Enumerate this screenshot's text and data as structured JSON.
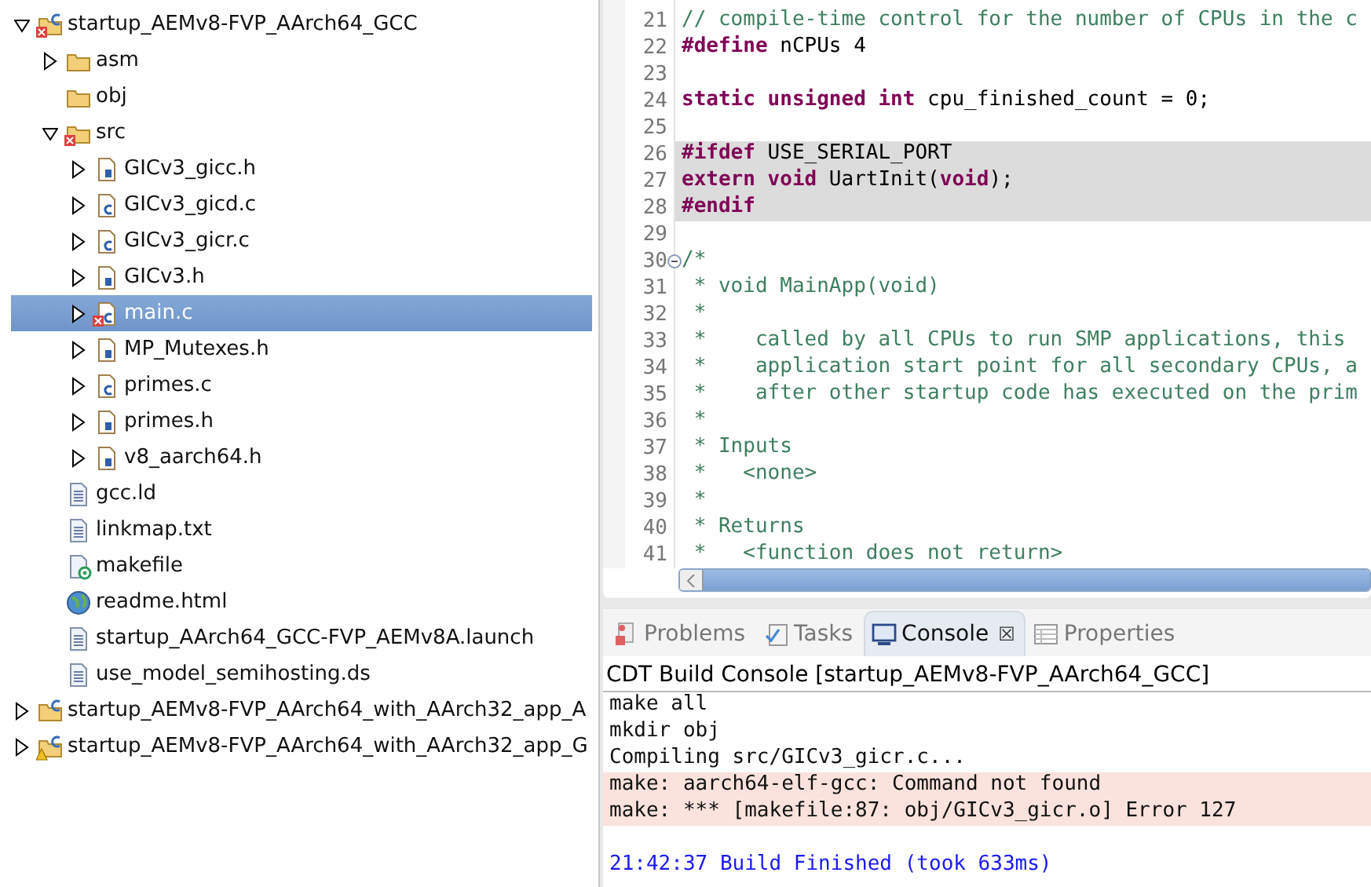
{
  "project_explorer": {
    "tree": [
      {
        "label": "startup_AEMv8-FVP_AArch64_GCC",
        "kind": "project",
        "error": true,
        "expanded": true,
        "selected": false,
        "children": [
          {
            "label": "asm",
            "kind": "folder",
            "expanded": false,
            "selected": false
          },
          {
            "label": "obj",
            "kind": "folder",
            "selected": false
          },
          {
            "label": "src",
            "kind": "folder",
            "error": true,
            "expanded": true,
            "selected": false,
            "children": [
              {
                "label": "GICv3_gicc.h",
                "kind": "header",
                "expanded": false,
                "selected": false
              },
              {
                "label": "GICv3_gicd.c",
                "kind": "source",
                "expanded": false,
                "selected": false
              },
              {
                "label": "GICv3_gicr.c",
                "kind": "source",
                "expanded": false,
                "selected": false
              },
              {
                "label": "GICv3.h",
                "kind": "header",
                "expanded": false,
                "selected": false
              },
              {
                "label": "main.c",
                "kind": "source",
                "error": true,
                "expanded": false,
                "selected": true
              },
              {
                "label": "MP_Mutexes.h",
                "kind": "header",
                "expanded": false,
                "selected": false
              },
              {
                "label": "primes.c",
                "kind": "source",
                "expanded": false,
                "selected": false
              },
              {
                "label": "primes.h",
                "kind": "header",
                "expanded": false,
                "selected": false
              },
              {
                "label": "v8_aarch64.h",
                "kind": "header",
                "expanded": false,
                "selected": false
              }
            ]
          },
          {
            "label": "gcc.ld",
            "kind": "text",
            "selected": false
          },
          {
            "label": "linkmap.txt",
            "kind": "text",
            "selected": false
          },
          {
            "label": "makefile",
            "kind": "makefile",
            "selected": false
          },
          {
            "label": "readme.html",
            "kind": "html",
            "selected": false
          },
          {
            "label": "startup_AArch64_GCC-FVP_AEMv8A.launch",
            "kind": "text",
            "selected": false
          },
          {
            "label": "use_model_semihosting.ds",
            "kind": "text",
            "selected": false
          }
        ]
      },
      {
        "label": "startup_AEMv8-FVP_AArch64_with_AArch32_app_A",
        "kind": "project",
        "expanded": false,
        "selected": false
      },
      {
        "label": "startup_AEMv8-FVP_AArch64_with_AArch32_app_G",
        "kind": "project",
        "warning": true,
        "expanded": false,
        "selected": false
      }
    ]
  },
  "editor": {
    "lines": [
      {
        "number": "21",
        "highlighted": false,
        "foldable": false,
        "tokens": [
          {
            "kind": "comment",
            "text": "// compile-time control for the number of CPUs in the c"
          }
        ]
      },
      {
        "number": "22",
        "highlighted": false,
        "foldable": false,
        "tokens": [
          {
            "kind": "keyword",
            "text": "#define"
          },
          {
            "kind": "plain",
            "text": " nCPUs 4"
          }
        ]
      },
      {
        "number": "23",
        "highlighted": false,
        "foldable": false
      },
      {
        "number": "24",
        "highlighted": false,
        "foldable": false,
        "tokens": [
          {
            "kind": "keyword",
            "text": "static unsigned int"
          },
          {
            "kind": "plain",
            "text": " cpu_finished_count = 0;"
          }
        ]
      },
      {
        "number": "25",
        "highlighted": false,
        "foldable": false
      },
      {
        "number": "26",
        "highlighted": true,
        "foldable": false,
        "tokens": [
          {
            "kind": "keyword",
            "text": "#ifdef"
          },
          {
            "kind": "plain",
            "text": " USE_SERIAL_PORT"
          }
        ]
      },
      {
        "number": "27",
        "highlighted": true,
        "foldable": false,
        "tokens": [
          {
            "kind": "keyword",
            "text": "extern void"
          },
          {
            "kind": "plain",
            "text": " UartInit("
          },
          {
            "kind": "keyword",
            "text": "void"
          },
          {
            "kind": "plain",
            "text": ");"
          }
        ]
      },
      {
        "number": "28",
        "highlighted": true,
        "foldable": false,
        "tokens": [
          {
            "kind": "keyword",
            "text": "#endif"
          }
        ]
      },
      {
        "number": "29",
        "highlighted": false,
        "foldable": false
      },
      {
        "number": "30",
        "highlighted": false,
        "foldable": true,
        "tokens": [
          {
            "kind": "comment",
            "text": "/*"
          }
        ]
      },
      {
        "number": "31",
        "highlighted": false,
        "foldable": false,
        "tokens": [
          {
            "kind": "comment",
            "text": " * void MainApp(void)"
          }
        ]
      },
      {
        "number": "32",
        "highlighted": false,
        "foldable": false,
        "tokens": [
          {
            "kind": "comment",
            "text": " *"
          }
        ]
      },
      {
        "number": "33",
        "highlighted": false,
        "foldable": false,
        "tokens": [
          {
            "kind": "comment",
            "text": " *    called by all CPUs to run SMP applications, this"
          }
        ]
      },
      {
        "number": "34",
        "highlighted": false,
        "foldable": false,
        "tokens": [
          {
            "kind": "comment",
            "text": " *    application start point for all secondary CPUs, a"
          }
        ]
      },
      {
        "number": "35",
        "highlighted": false,
        "foldable": false,
        "tokens": [
          {
            "kind": "comment",
            "text": " *    after other startup code has executed on the prim"
          }
        ]
      },
      {
        "number": "36",
        "highlighted": false,
        "foldable": false,
        "tokens": [
          {
            "kind": "comment",
            "text": " *"
          }
        ]
      },
      {
        "number": "37",
        "highlighted": false,
        "foldable": false,
        "tokens": [
          {
            "kind": "comment",
            "text": " * Inputs"
          }
        ]
      },
      {
        "number": "38",
        "highlighted": false,
        "foldable": false,
        "tokens": [
          {
            "kind": "comment",
            "text": " *   <none>"
          }
        ]
      },
      {
        "number": "39",
        "highlighted": false,
        "foldable": false,
        "tokens": [
          {
            "kind": "comment",
            "text": " *"
          }
        ]
      },
      {
        "number": "40",
        "highlighted": false,
        "foldable": false,
        "tokens": [
          {
            "kind": "comment",
            "text": " * Returns"
          }
        ]
      },
      {
        "number": "41",
        "highlighted": false,
        "foldable": false,
        "tokens": [
          {
            "kind": "comment",
            "text": " *   <function does not return>"
          }
        ]
      }
    ]
  },
  "bottom_panel": {
    "tabs": [
      {
        "label": "Problems",
        "kind": "problems",
        "selected": false
      },
      {
        "label": "Tasks",
        "kind": "tasks",
        "selected": false
      },
      {
        "label": "Console",
        "kind": "console",
        "selected": true,
        "close": "☒"
      },
      {
        "label": "Properties",
        "kind": "properties",
        "selected": false
      }
    ],
    "console_title": "CDT Build Console [startup_AEMv8-FVP_AArch64_GCC]",
    "console_lines": [
      {
        "kind": "normal",
        "text": "make all"
      },
      {
        "kind": "normal",
        "text": "mkdir obj"
      },
      {
        "kind": "normal",
        "text": "Compiling src/GICv3_gicr.c..."
      },
      {
        "kind": "error",
        "text": "make: aarch64-elf-gcc: Command not found"
      },
      {
        "kind": "error",
        "text": "make: *** [makefile:87: obj/GICv3_gicr.o] Error 127"
      },
      {
        "kind": "blank"
      },
      {
        "kind": "info",
        "text": "21:42:37 Build Finished (took 633ms)"
      }
    ]
  }
}
